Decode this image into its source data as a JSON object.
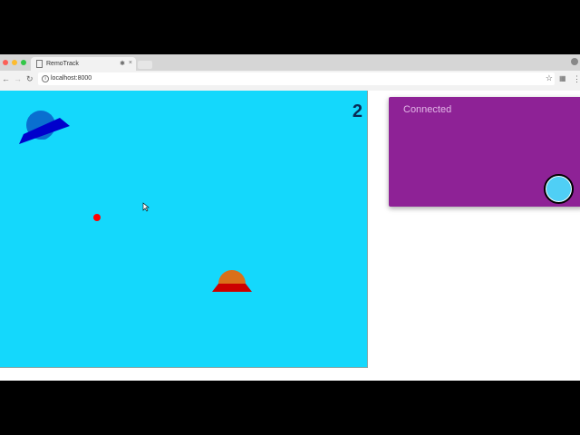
{
  "browser": {
    "tab_title": "RemoTrack",
    "url": "localhost:8000"
  },
  "game": {
    "score": "2"
  },
  "panel": {
    "status": "Connected"
  },
  "colors": {
    "field": "#14d8fc",
    "panel": "#8e2296",
    "button": "#4fcff5",
    "player1": "#0a6fd0",
    "player2": "#d9701a",
    "ball": "#ff0000"
  }
}
